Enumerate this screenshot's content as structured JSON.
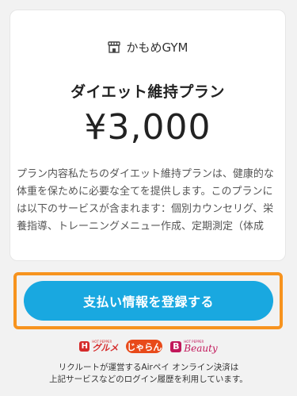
{
  "store": {
    "name": "かもめGYM",
    "icon": "storefront-icon"
  },
  "plan": {
    "title": "ダイエット維持プラン",
    "price": "¥3,000",
    "description": "プラン内容私たちのダイエット維持プランは、健康的な体重を保ために必要な全てを提供します。このプランには以下のサービスが含まれます：個別カウンセリグ、栄養指導、トレーニングメニュー作成、定期測定（体成"
  },
  "actions": {
    "register_payment_label": "支払い情報を登録する"
  },
  "colors": {
    "button": "#19a8e0",
    "highlight_border": "#f7931e"
  },
  "logos": {
    "gourmet": {
      "small": "HOT PEPPER",
      "big": "グルメ",
      "mark": "H"
    },
    "jalan": {
      "text": "じゃらん"
    },
    "beauty": {
      "small": "HOT PEPPER",
      "big": "Beauty",
      "mark": "B"
    }
  },
  "footer": {
    "line1": "リクルートが運営するAirペイ オンライン決済は",
    "line2": "上記サービスなどのログイン履歴を利用しています。"
  }
}
